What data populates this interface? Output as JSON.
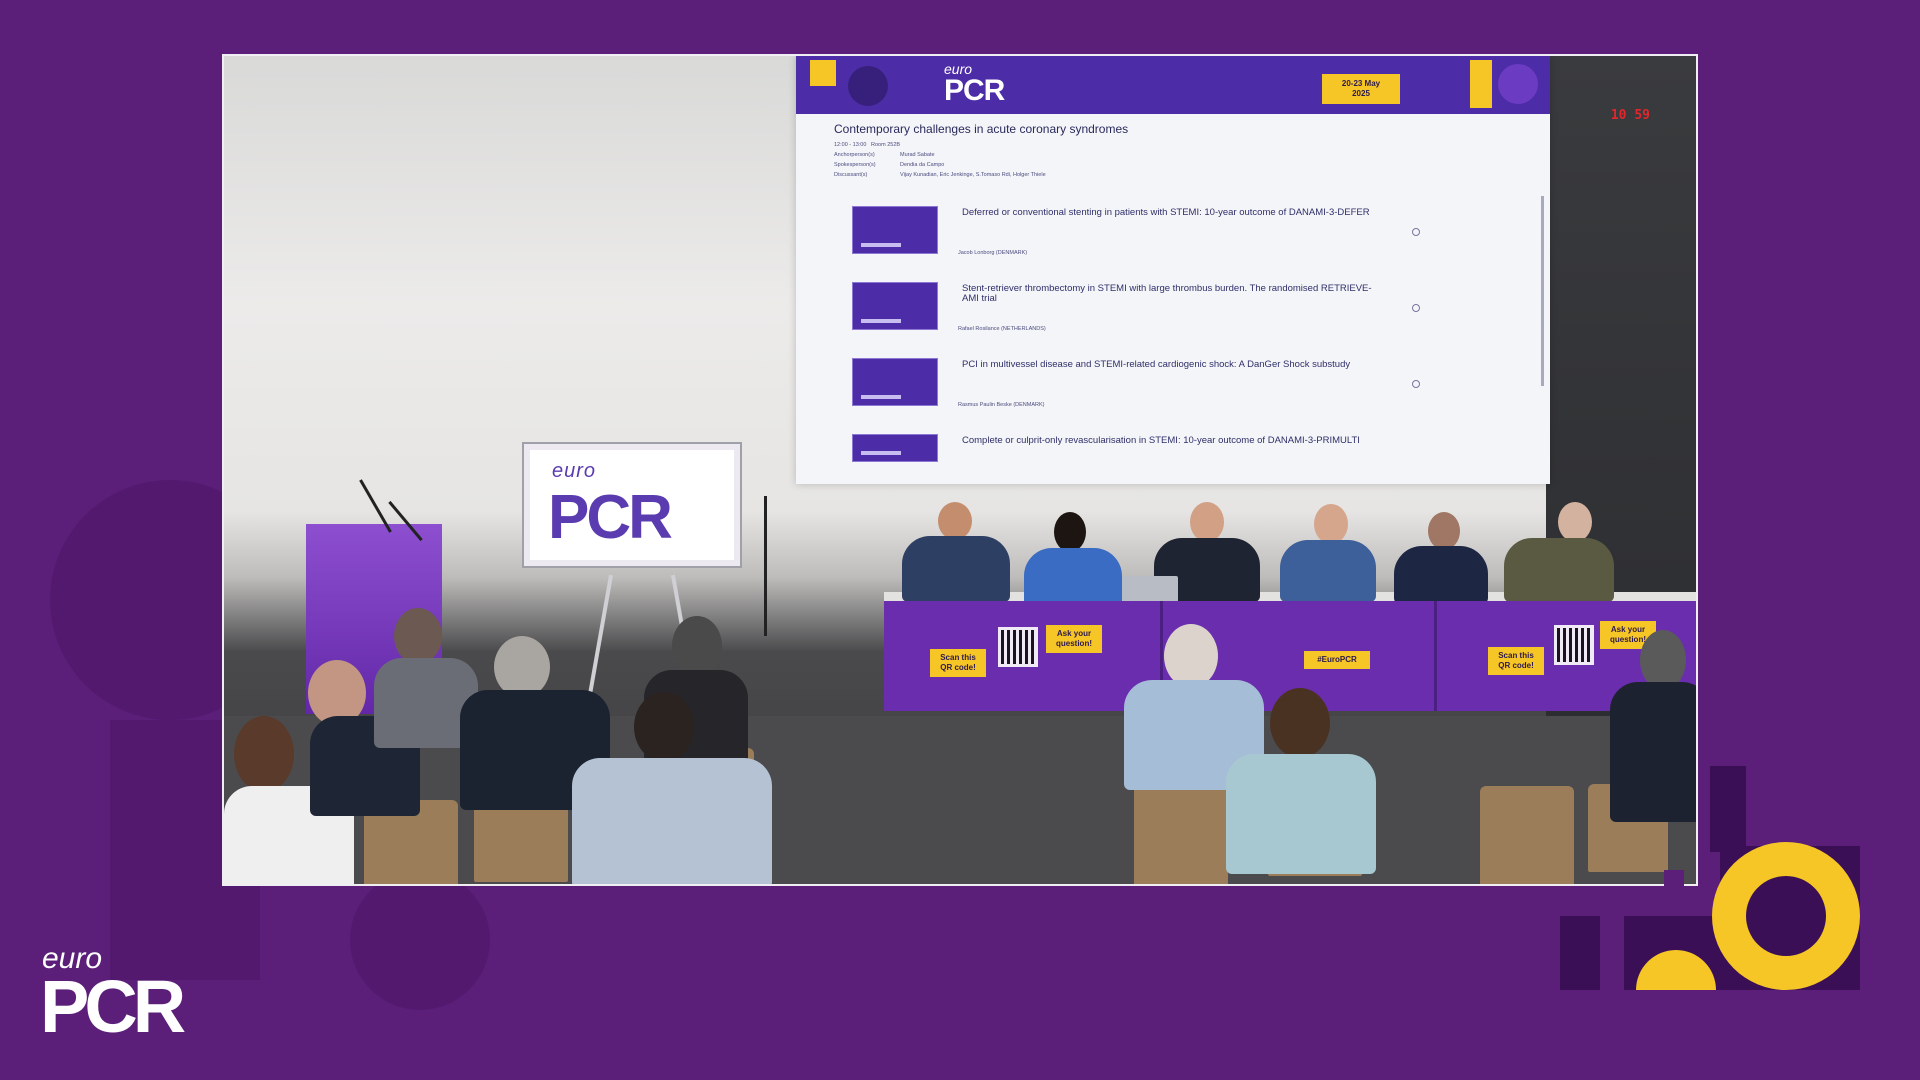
{
  "brand": {
    "corner_logo_small": "euro",
    "corner_logo_large": "PCR"
  },
  "stream": {
    "clock": "10 59",
    "sign_small": "euro",
    "sign_large": "PCR"
  },
  "slide": {
    "header_logo_small": "euro",
    "header_logo_large": "PCR",
    "date_chip_line1": "20-23 May",
    "date_chip_line2": "2025",
    "title": "Contemporary challenges in acute coronary syndromes",
    "meta_time": "12:00 - 13:00",
    "meta_room": "Room 252B",
    "meta_rows": [
      {
        "role": "Anchorperson(s)",
        "names": "Murad Sabate"
      },
      {
        "role": "Spokesperson(s)",
        "names": "Dendia da Campo"
      },
      {
        "role": "Discussant(s)",
        "names": "Vijay Kunadian, Eric Jenkinge, S.Tomaso Rdi, Holger Thiele"
      }
    ],
    "talks": [
      {
        "title": "Deferred or conventional stenting in patients with STEMI: 10-year outcome of DANAMI-3-DEFER",
        "speaker": "Jacob Lonborg (DENMARK)"
      },
      {
        "title": "Stent-retriever thrombectomy in STEMI with large thrombus burden. The randomised RETRIEVE-AMI trial",
        "speaker": "Rafael Rosilance (NETHERLANDS)"
      },
      {
        "title": "PCI in multivessel disease and STEMI-related cardiogenic shock: A DanGer Shock substudy",
        "speaker": "Rasmus Paulin Beske (DENMARK)"
      },
      {
        "title": "Complete or culprit-only revascularisation in STEMI: 10-year outcome of DANAMI-3-PRIMULTI",
        "speaker": ""
      }
    ]
  },
  "table_signs": {
    "scan_label_1": "Scan this",
    "scan_label_2": "QR code!",
    "ask_label_1": "Ask your",
    "ask_label_2": "question!",
    "hashtag": "#EuroPCR"
  },
  "colors": {
    "background": "#5b1f7a",
    "accent_yellow": "#f6c526",
    "slide_header": "#4d2ca7"
  }
}
